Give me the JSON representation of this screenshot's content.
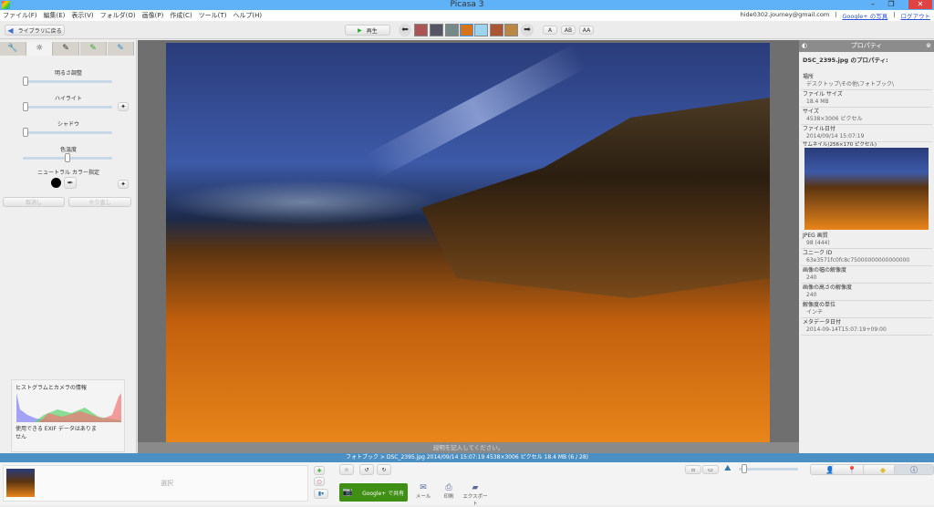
{
  "window": {
    "title": "Picasa 3",
    "minimize": "–",
    "maximize": "❐",
    "close": "✕"
  },
  "menu": [
    "ファイル(F)",
    "編集(E)",
    "表示(V)",
    "フォルダ(O)",
    "画像(P)",
    "作成(C)",
    "ツール(T)",
    "ヘルプ(H)"
  ],
  "account": {
    "email": "hide0302.journey@gmail.com",
    "sep": "|",
    "photos_link": "Google+ の写真",
    "logout_link": "ログアウト"
  },
  "toolbar": {
    "back_label": "ライブラリに戻る",
    "play_label": "再生",
    "view_modes": [
      "A",
      "AB",
      "AA"
    ]
  },
  "left_panel": {
    "tabs": [
      "wrench-icon",
      "sun-icon",
      "brush-icon",
      "green-brush-icon",
      "blue-brush-icon"
    ],
    "fill_light_label": "明るさ調整",
    "fill_light": 0,
    "highlights_label": "ハイライト",
    "highlights": 0,
    "shadows_label": "シャドウ",
    "shadows": 0,
    "color_temp_label": "色温度",
    "color_temp": 0.5,
    "neutral_color_label": "ニュートラル カラー指定",
    "undo_label": "取消し",
    "redo_label": "やり直し",
    "histogram_title": "ヒストグラムとカメラの情報",
    "exif_note": "使用できる EXIF データはありません"
  },
  "main": {
    "caption_placeholder": "説明を記入してください。"
  },
  "properties": {
    "title": "プロパティ",
    "heading": "DSC_2395.jpg のプロパティ:",
    "items": [
      {
        "k": "場所",
        "v": "デスクトップ\\その他\\フォトブック\\"
      },
      {
        "k": "ファイル サイズ",
        "v": "18.4 MB"
      },
      {
        "k": "サイズ",
        "v": "4538×3006 ピクセル"
      },
      {
        "k": "ファイル日付",
        "v": "2014/09/14 15:07:19"
      }
    ],
    "thumbnail_label": "サムネイル(256×170 ピクセル)",
    "items2": [
      {
        "k": "JPEG 画質",
        "v": "98 (444)"
      },
      {
        "k": "ユニーク ID",
        "v": "63e3571fc0fc8c75000000000000000"
      },
      {
        "k": "画像の幅の解像度",
        "v": "240"
      },
      {
        "k": "画像の高さの解像度",
        "v": "240"
      },
      {
        "k": "解像度の単位",
        "v": "インチ"
      },
      {
        "k": "メタデータ日付",
        "v": "2014-09-14T15:07:19+09:00"
      }
    ]
  },
  "status": {
    "text": "フォトブック > DSC_2395.jpg 2014/09/14 15:07:19 4538×3006 ピクセル 18.4 MB   (6 / 28)"
  },
  "bottom": {
    "selection_label": "選択",
    "share_label": "Google+ で共有",
    "email_label": "メール",
    "print_label": "印刷",
    "export_label": "エクスポート",
    "zoom": 0.05
  },
  "colors": {
    "titlebar": "#5fb2f7",
    "status": "#4b8fc3",
    "share": "#3f8f14"
  }
}
